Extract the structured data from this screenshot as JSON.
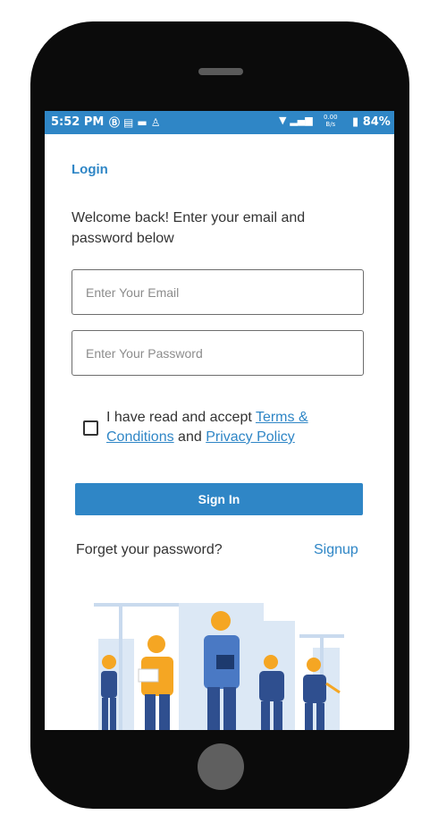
{
  "status_bar": {
    "time": "5:52 PM",
    "icons": [
      "circle-b-icon",
      "message-icon",
      "chat-icon",
      "accessibility-icon"
    ],
    "network_icons": [
      "wifi-icon",
      "signal-icon"
    ],
    "speed_value": "0.00",
    "speed_unit": "B/s",
    "battery_percent": "84%"
  },
  "login": {
    "title": "Login",
    "welcome": "Welcome back! Enter your email and password below",
    "email_placeholder": "Enter Your Email",
    "password_placeholder": "Enter Your Password",
    "agree_prefix": "I have read and accept ",
    "terms_link": "Terms & Conditions",
    "agree_middle": " and ",
    "privacy_link": "Privacy Policy",
    "signin_label": "Sign In",
    "forgot_label": "Forget your password?",
    "signup_label": "Signup"
  },
  "colors": {
    "accent": "#2f86c6",
    "phone_body": "#0b0b0b",
    "worker_vest": "#f5a623",
    "worker_suit": "#2f4f8f"
  }
}
